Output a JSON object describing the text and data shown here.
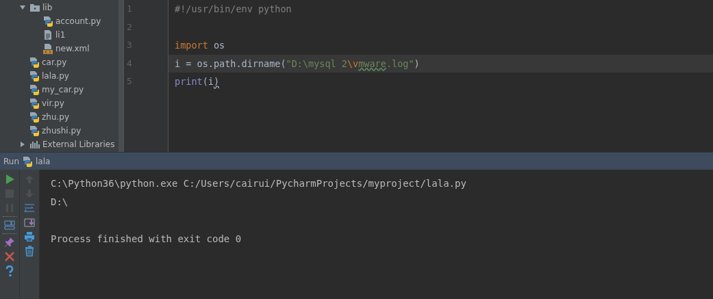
{
  "project_tree": {
    "items": [
      {
        "label": "lib",
        "kind": "folder",
        "expanded": true,
        "children": [
          {
            "label": "account.py",
            "kind": "python"
          },
          {
            "label": "li1",
            "kind": "text"
          },
          {
            "label": "new.xml",
            "kind": "xml"
          }
        ]
      },
      {
        "label": "car.py",
        "kind": "python"
      },
      {
        "label": "lala.py",
        "kind": "python"
      },
      {
        "label": "my_car.py",
        "kind": "python"
      },
      {
        "label": "vir.py",
        "kind": "python"
      },
      {
        "label": "zhu.py",
        "kind": "python"
      },
      {
        "label": "zhushi.py",
        "kind": "python"
      },
      {
        "label": "External Libraries",
        "kind": "libraries",
        "expanded": false
      }
    ]
  },
  "editor": {
    "lines": [
      {
        "number": "1",
        "current": false,
        "tokens": [
          {
            "text": "#!/usr/bin/env python",
            "kind": "comment"
          }
        ]
      },
      {
        "number": "2",
        "current": false
      },
      {
        "number": "3",
        "current": false,
        "tokens": [
          {
            "text": "import",
            "kind": "keyword"
          },
          {
            "text": " os",
            "kind": "plain"
          }
        ]
      },
      {
        "number": "4",
        "current": true,
        "tokens": [
          {
            "text": "i = os.path.dirname(",
            "kind": "plain"
          },
          {
            "text": "\"D:\\mysql 2",
            "kind": "string"
          },
          {
            "text": "\\v",
            "kind": "escape"
          },
          {
            "text": "mware",
            "kind": "typo"
          },
          {
            "text": ".log\"",
            "kind": "string"
          },
          {
            "text": ")",
            "kind": "plain"
          }
        ]
      },
      {
        "number": "5",
        "current": false,
        "tokens": [
          {
            "text": "print",
            "kind": "builtin"
          },
          {
            "text": "(i",
            "kind": "plain"
          },
          {
            "text": ")",
            "kind": "warning"
          }
        ]
      }
    ]
  },
  "run_panel": {
    "label": "Run",
    "config": "lala",
    "tools_left": [
      {
        "kind": "run",
        "disabled": false
      },
      {
        "kind": "stop",
        "disabled": true
      },
      {
        "kind": "pause",
        "disabled": true
      },
      {
        "kind": "layout",
        "disabled": false
      },
      {
        "kind": "pin",
        "disabled": false
      },
      {
        "kind": "close",
        "disabled": false
      },
      {
        "kind": "help",
        "disabled": false
      }
    ],
    "tools_right": [
      {
        "kind": "up",
        "disabled": true
      },
      {
        "kind": "down",
        "disabled": true
      },
      {
        "kind": "wrap",
        "disabled": false
      },
      {
        "kind": "scroll-end",
        "disabled": false
      },
      {
        "kind": "print",
        "disabled": false
      },
      {
        "kind": "trash",
        "disabled": false
      }
    ],
    "console_blocks": [
      [
        "C:\\Python36\\python.exe C:/Users/cairui/PycharmProjects/myproject/lala.py",
        "D:\\"
      ],
      [
        "Process finished with exit code 0"
      ]
    ]
  }
}
